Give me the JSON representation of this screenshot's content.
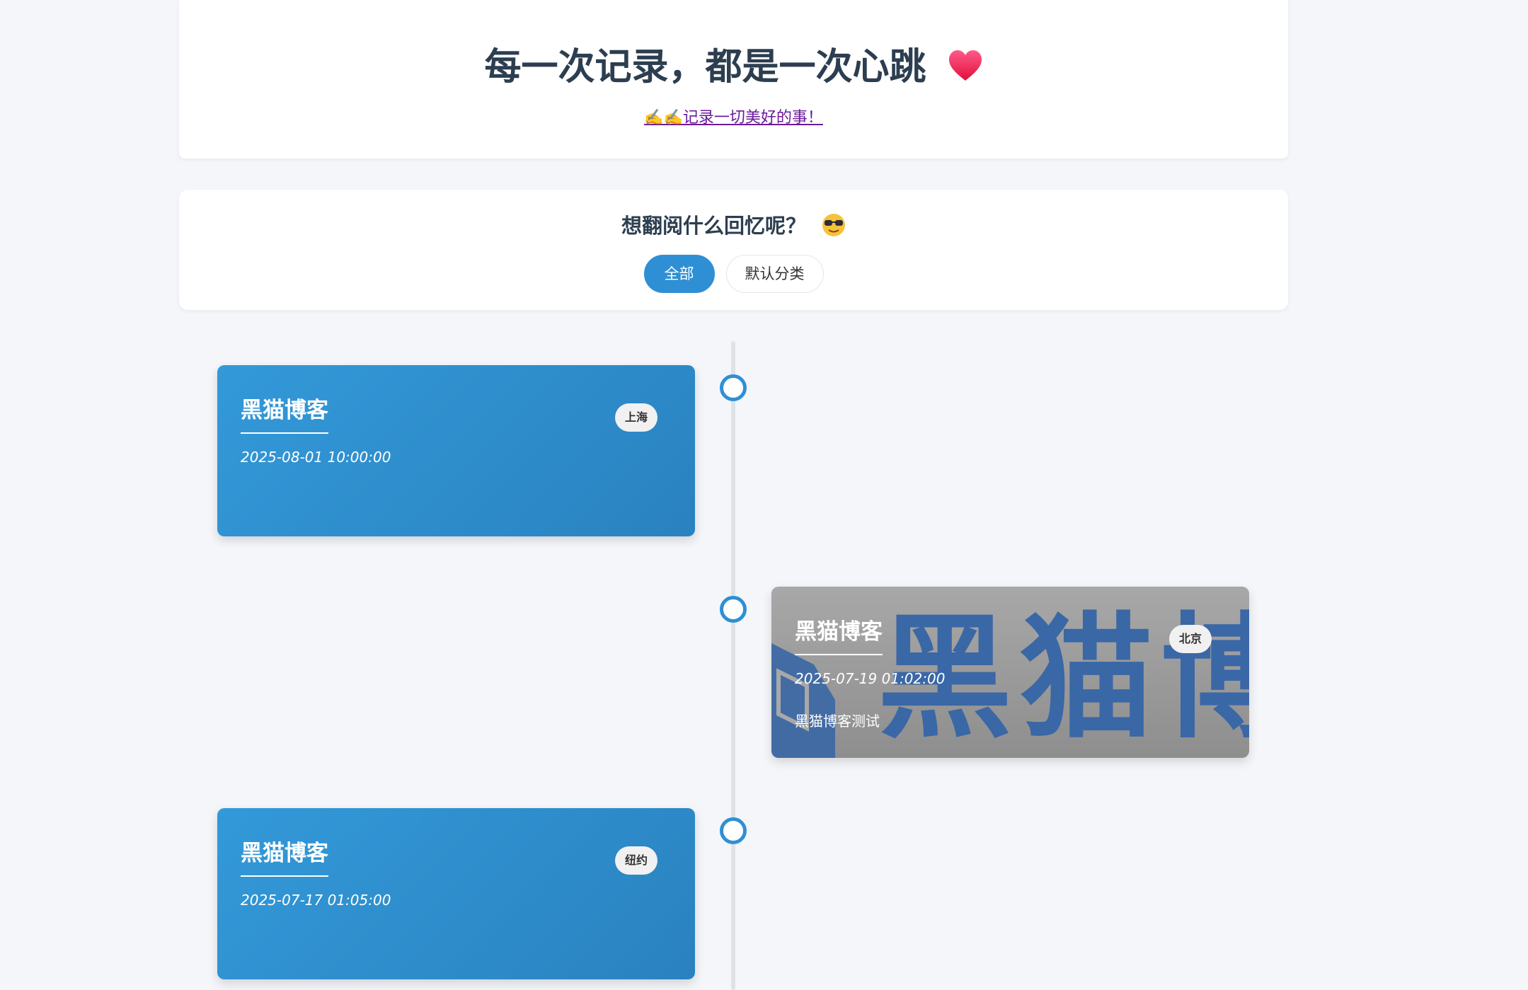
{
  "header": {
    "title": "每一次记录，都是一次心跳",
    "link_text": "✍️✍️记录一切美好的事！"
  },
  "filter": {
    "title": "想翻阅什么回忆呢？",
    "buttons": [
      "全部",
      "默认分类"
    ],
    "active_index": 0
  },
  "entries": [
    {
      "title": "黑猫博客",
      "date": "2025-08-01 10:00:00",
      "location": "上海",
      "description": ""
    },
    {
      "title": "黑猫博客",
      "date": "2025-07-19 01:02:00",
      "location": "北京",
      "description": "黑猫博客测试",
      "watermark_text": "黑猫博客"
    },
    {
      "title": "黑猫博客",
      "date": "2025-07-17 01:05:00",
      "location": "纽约",
      "description": ""
    }
  ],
  "colors": {
    "accent": "#2f8fd4",
    "title_text": "#2c3e50",
    "link": "#6a1b9a",
    "background": "#f4f6fa"
  },
  "icons": [
    "heart-icon",
    "writing-hand-icon",
    "sunglasses-icon"
  ]
}
